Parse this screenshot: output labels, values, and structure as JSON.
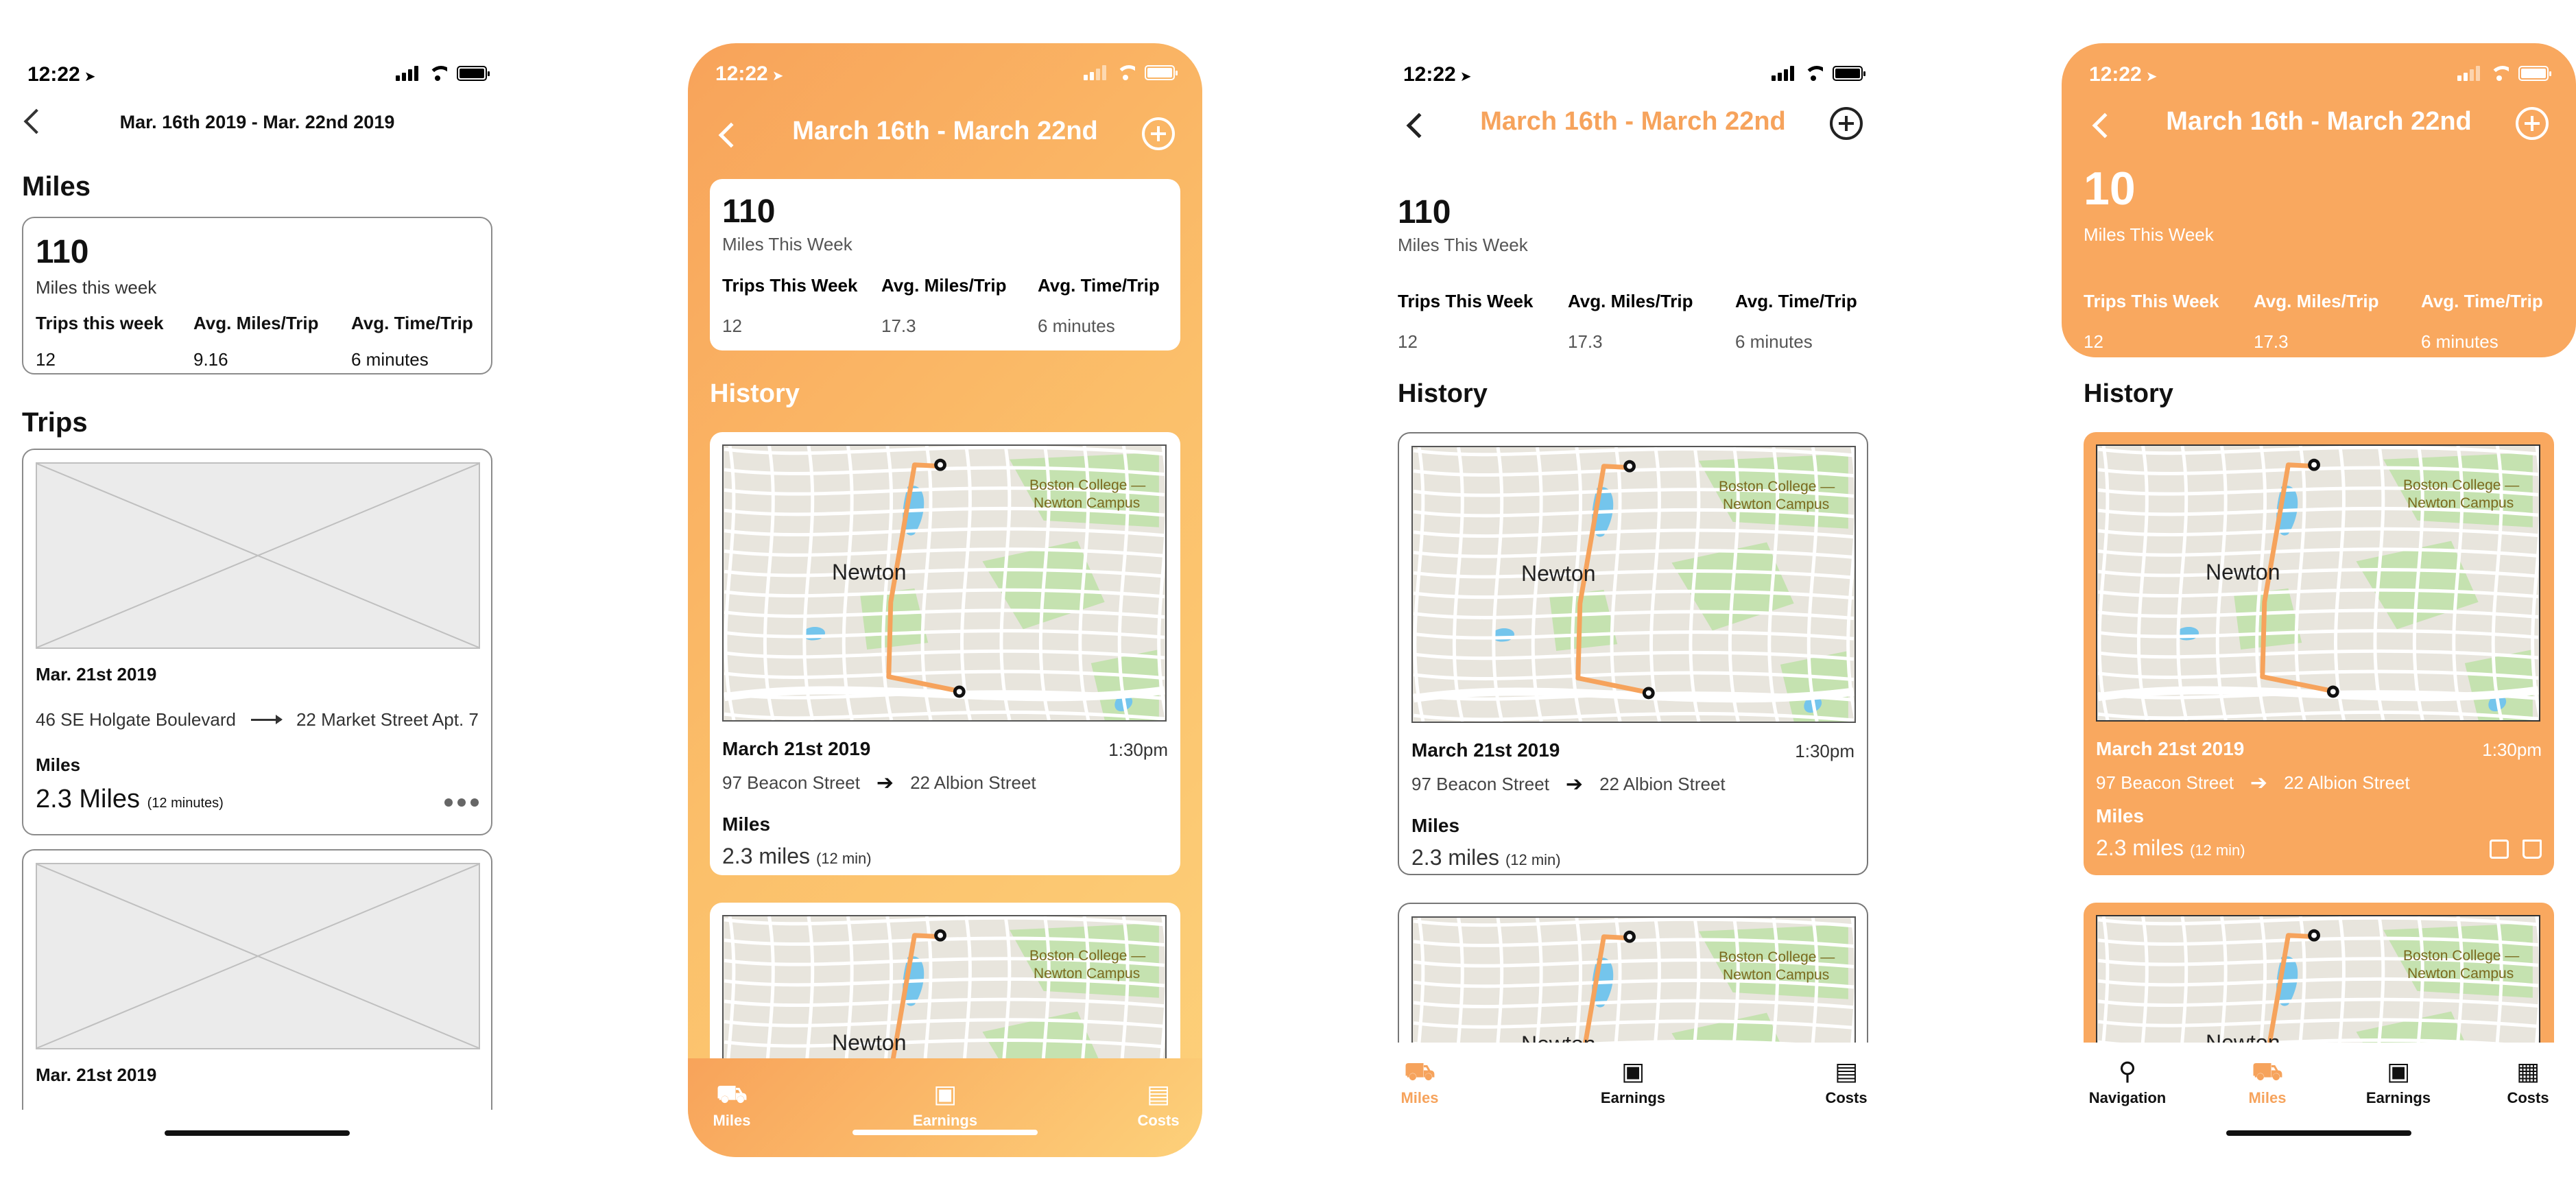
{
  "status": {
    "time": "12:22"
  },
  "wireframe": {
    "title": "Mar. 16th 2019 - Mar. 22nd 2019",
    "miles_heading": "Miles",
    "miles_value": "110",
    "miles_caption": "Miles this week",
    "stats": [
      {
        "label": "Trips this week",
        "value": "12"
      },
      {
        "label": "Avg. Miles/Trip",
        "value": "9.16"
      },
      {
        "label": "Avg. Time/Trip",
        "value": "6 minutes"
      }
    ],
    "trips_heading": "Trips",
    "trip": {
      "date": "Mar. 21st 2019",
      "from": "46 SE Holgate Boulevard",
      "to": "22 Market Street Apt. 7",
      "miles_label": "Miles",
      "miles_value": "2.3 Miles",
      "duration": "(12 minutes)"
    },
    "trip2_date": "Mar. 21st 2019"
  },
  "hifi": {
    "title": "March 16th - March 22nd",
    "miles_value": "110",
    "miles_value_alt": "10",
    "miles_caption": "Miles This Week",
    "stats": [
      {
        "label": "Trips This Week",
        "value": "12"
      },
      {
        "label": "Avg. Miles/Trip",
        "value": "17.3"
      },
      {
        "label": "Avg. Time/Trip",
        "value": "6 minutes"
      }
    ],
    "history_heading": "History",
    "trip": {
      "date": "March 21st 2019",
      "time": "1:30pm",
      "from": "97 Beacon Street",
      "to": "22 Albion Street",
      "miles_label": "Miles",
      "miles_value": "2.3 miles",
      "duration": "(12 min)"
    },
    "map": {
      "city_label": "Newton",
      "campus_label_1": "Boston College —",
      "campus_label_2": "Newton Campus",
      "city_label_cut": "Newton"
    },
    "tabs": [
      "Miles",
      "Earnings",
      "Costs"
    ],
    "tabs4": [
      "Navigation",
      "Miles",
      "Earnings",
      "Costs"
    ]
  },
  "colors": {
    "accent": "#f6a35c",
    "gradient_start": "#f8a35a",
    "gradient_end": "#fdd17a",
    "orange": "#f9a85f"
  },
  "icons": {
    "back": "chevron-left-icon",
    "add": "plus-circle-icon",
    "van": "van-icon",
    "wallet": "wallet-icon",
    "receipt": "receipt-icon",
    "pin": "map-pin-icon",
    "calculator": "calculator-icon",
    "edit": "edit-icon",
    "trash": "trash-icon"
  }
}
